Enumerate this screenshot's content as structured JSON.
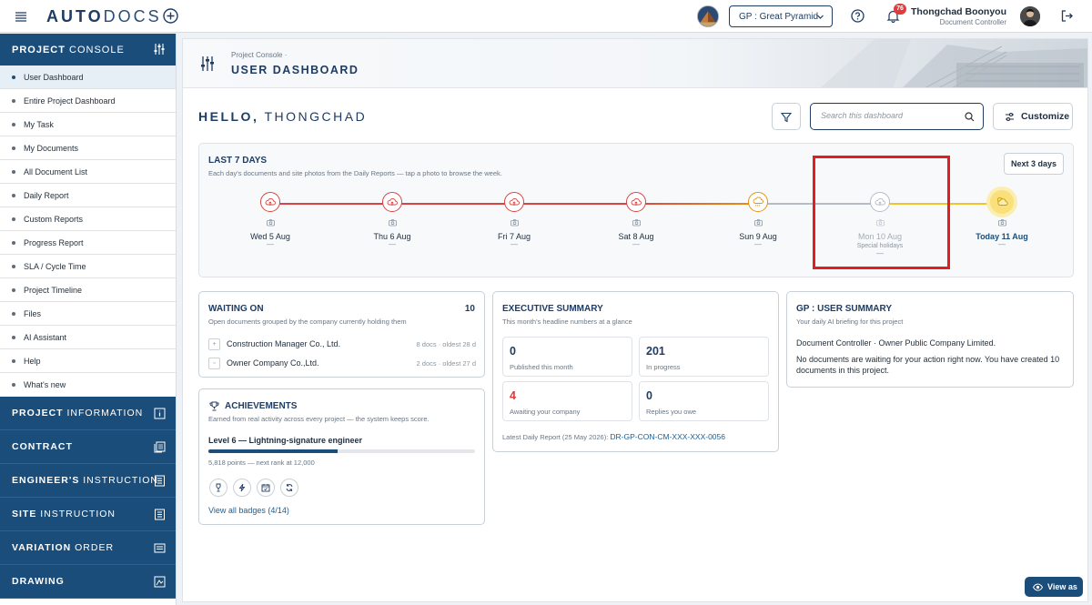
{
  "app": {
    "logo_part1": "AUTO",
    "logo_part2": "DOCS"
  },
  "topbar": {
    "project_select": "GP : Great Pyramid",
    "notif_count": "76",
    "user_name": "Thongchad Boonyou",
    "user_role": "Document Controller"
  },
  "sidebar": {
    "console_title_bold": "PROJECT",
    "console_title_rest": " CONSOLE",
    "items": [
      "User Dashboard",
      "Entire Project Dashboard",
      "My Task",
      "My Documents",
      "All Document List",
      "Daily Report",
      "Custom Reports",
      "Progress Report",
      "SLA / Cycle Time",
      "Project Timeline",
      "Files",
      "AI Assistant",
      "Help",
      "What's new"
    ],
    "sections": [
      {
        "bold": "PROJECT",
        "rest": " INFORMATION"
      },
      {
        "bold": "CONTRACT",
        "rest": ""
      },
      {
        "bold": "ENGINEER'S",
        "rest": " INSTRUCTION"
      },
      {
        "bold": "SITE",
        "rest": " INSTRUCTION"
      },
      {
        "bold": "VARIATION",
        "rest": " ORDER"
      },
      {
        "bold": "DRAWING",
        "rest": ""
      }
    ]
  },
  "header": {
    "breadcrumb": "Project Console ·",
    "title": "USER DASHBOARD"
  },
  "greeting": {
    "hello": "HELLO,",
    "name": "THONGCHAD"
  },
  "search": {
    "placeholder": "Search this dashboard"
  },
  "customize_label": "Customize",
  "last7": {
    "title": "LAST 7 DAYS",
    "subtitle": "Each day's documents and site photos from the Daily Reports — tap a photo to browse the week.",
    "next_label": "Next 3 days",
    "days": [
      {
        "label": "Wed 5 Aug",
        "sub": "",
        "dash": "—"
      },
      {
        "label": "Thu 6 Aug",
        "sub": "",
        "dash": "—"
      },
      {
        "label": "Fri 7 Aug",
        "sub": "",
        "dash": "—"
      },
      {
        "label": "Sat 8 Aug",
        "sub": "",
        "dash": "—"
      },
      {
        "label": "Sun 9 Aug",
        "sub": "",
        "dash": "—"
      },
      {
        "label": "Mon 10 Aug",
        "sub": "Special holidays",
        "dash": "—"
      },
      {
        "label": "Today 11 Aug",
        "sub": "",
        "dash": "—"
      }
    ],
    "colors": {
      "past": "#d64545",
      "sunday": "#e8920f",
      "holiday": "#b5bcc4",
      "today": "#f2c42b"
    }
  },
  "waiting": {
    "title": "WAITING ON",
    "count": "10",
    "subtitle": "Open documents grouped by the company currently holding them",
    "rows": [
      {
        "company": "Construction Manager Co., Ltd.",
        "meta": "8 docs · oldest 28 d"
      },
      {
        "company": "Owner Company Co.,Ltd.",
        "meta": "2 docs · oldest 27 d"
      }
    ]
  },
  "achievements": {
    "title": "ACHIEVEMENTS",
    "subtitle": "Earned from real activity across every project — the system keeps score.",
    "level": "Level 6 — Lightning-signature engineer",
    "points": "5,818 points — next rank at 12,000",
    "progress_fraction": 0.485,
    "view_all": "View all badges (4/14)"
  },
  "executive": {
    "title": "EXECUTIVE SUMMARY",
    "subtitle": "This month's headline numbers at a glance",
    "tiles": [
      {
        "value": "0",
        "label": "Published this month"
      },
      {
        "value": "201",
        "label": "In progress"
      },
      {
        "value": "4",
        "label": "Awaiting your company"
      },
      {
        "value": "0",
        "label": "Replies you owe"
      }
    ],
    "latest_prefix": "Latest Daily Report (25 May 2026):",
    "latest_link": "DR-GP-CON-CM-XXX-XXX-0056"
  },
  "gp_summary": {
    "title": "GP : USER SUMMARY",
    "subtitle": "Your daily AI briefing for this project",
    "line1": "Document Controller · Owner Public Company Limited.",
    "line2": "No documents are waiting for your action right now. You have created 10 documents in this project."
  },
  "view_as_label": "View as"
}
